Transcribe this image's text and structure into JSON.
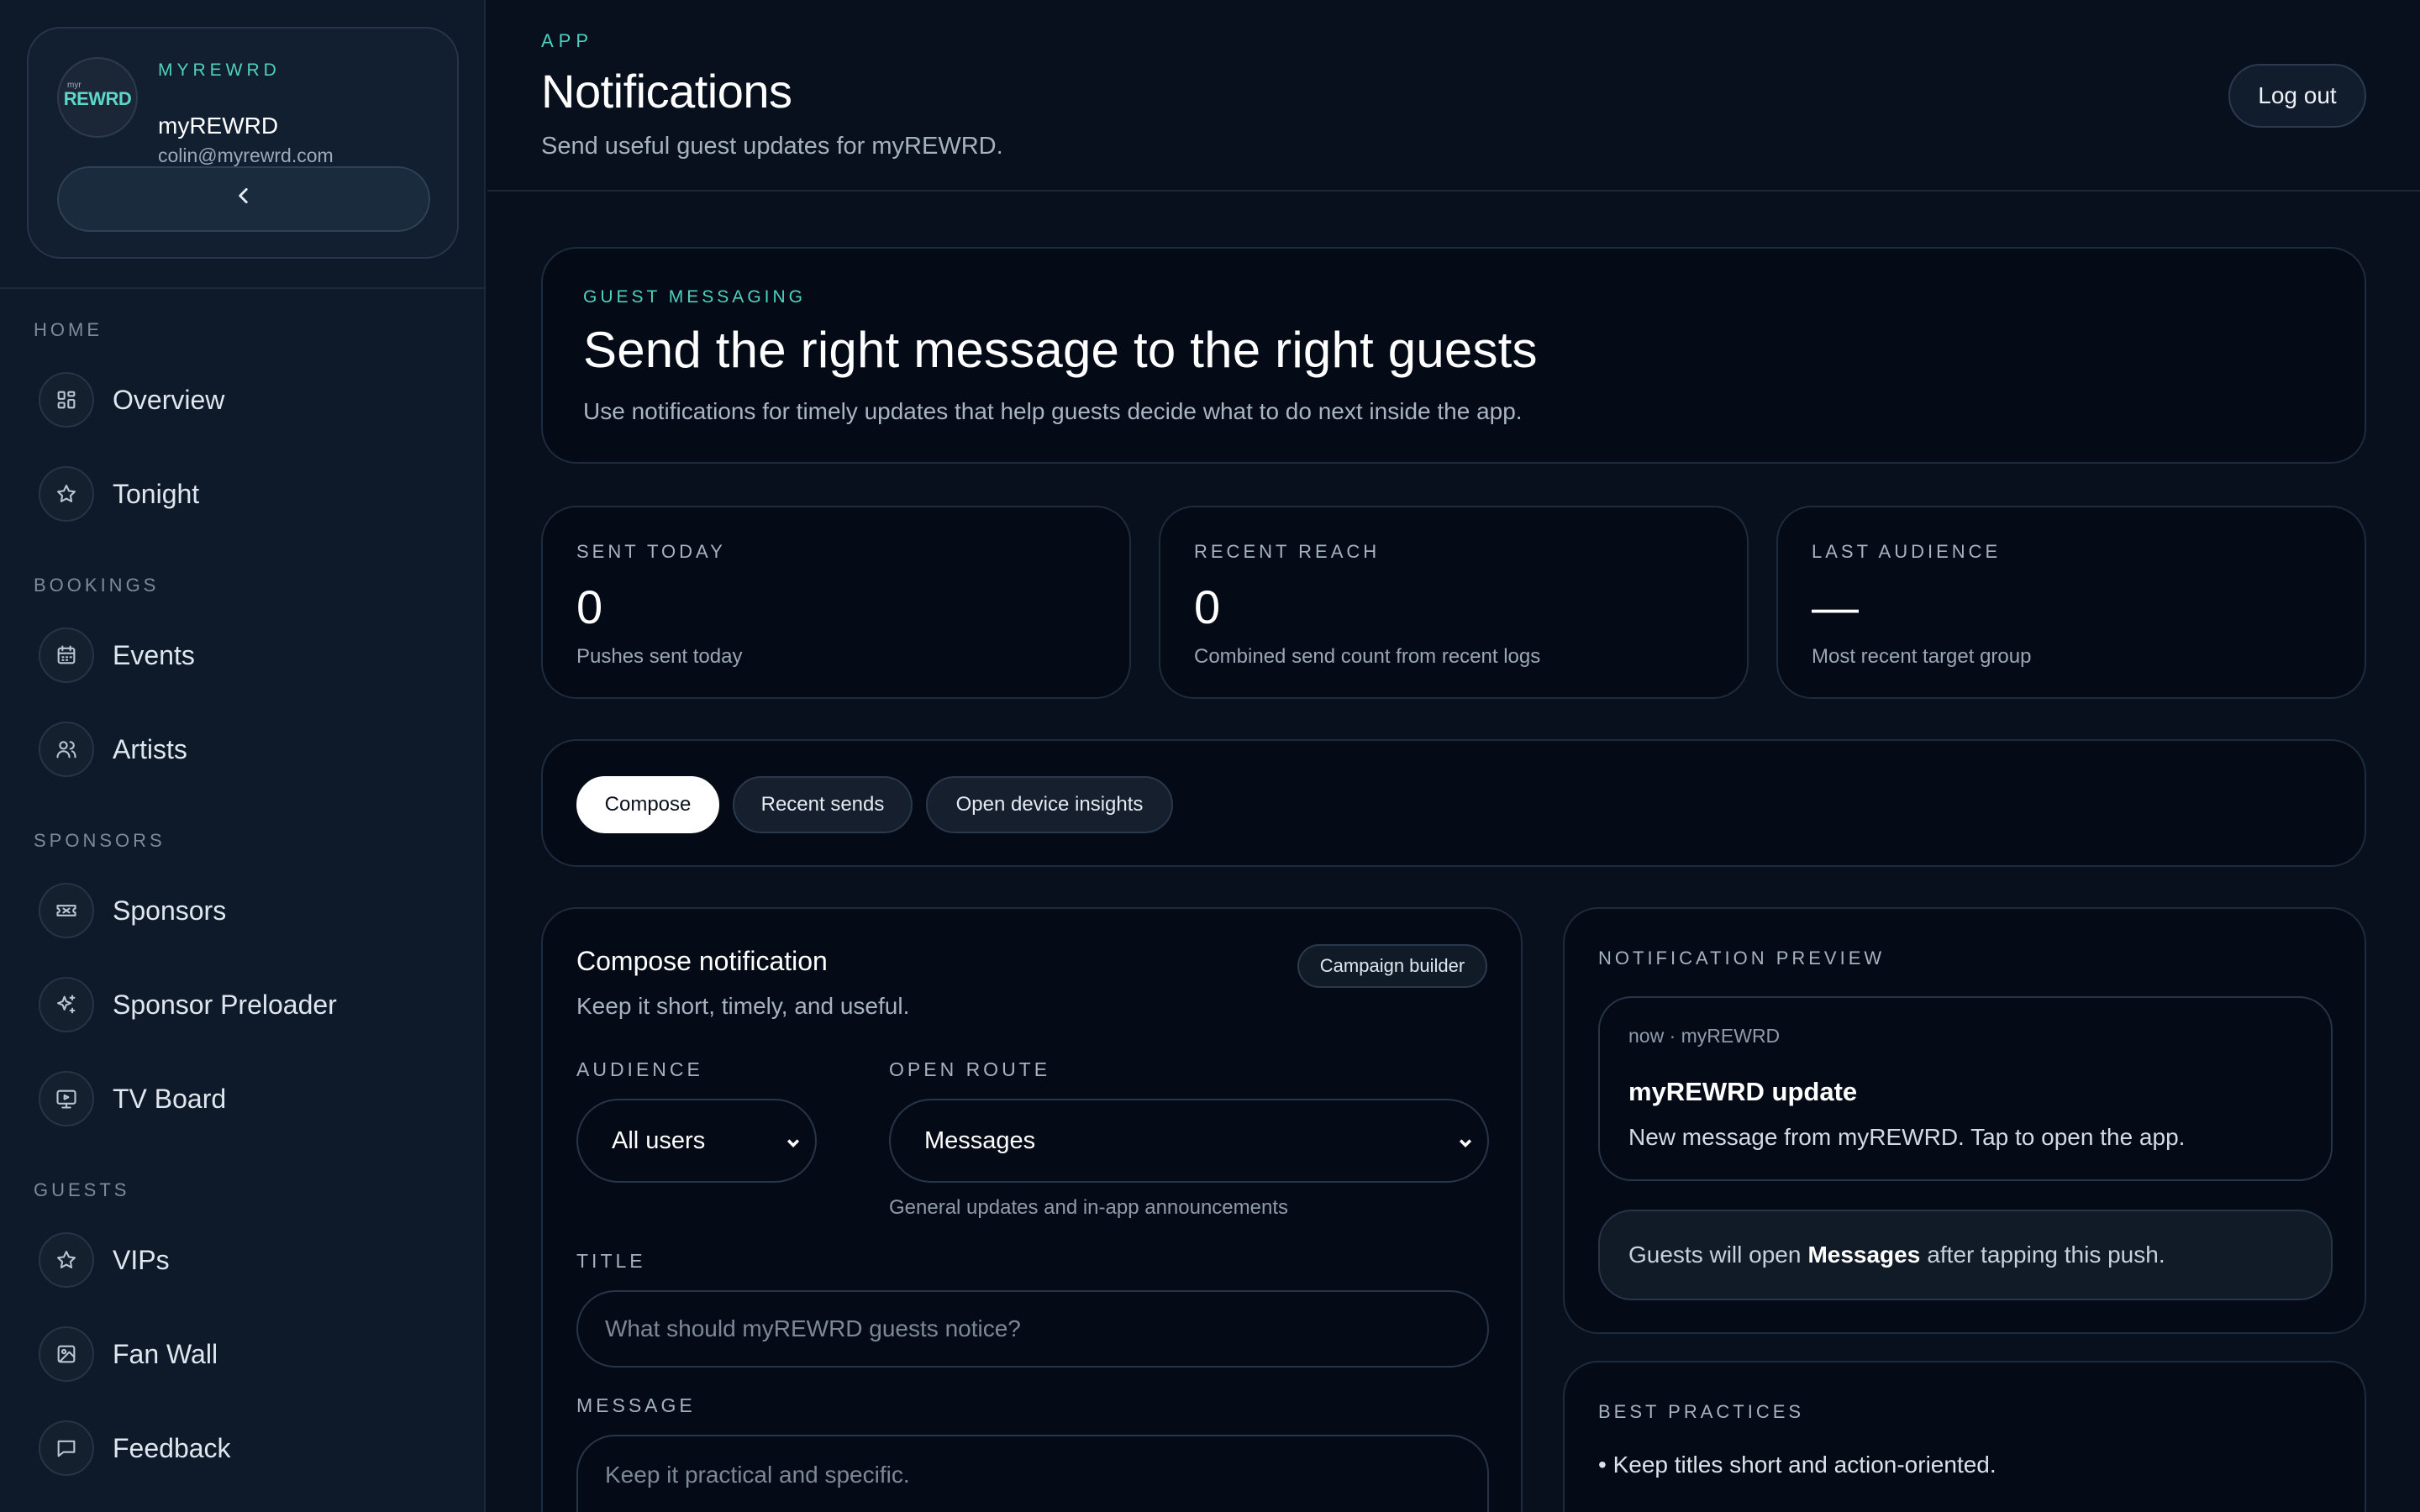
{
  "sidebar": {
    "profile": {
      "logo_small": "myr",
      "logo_text": "REWRD",
      "eyebrow": "MYREWRD",
      "name": "myREWRD",
      "email": "colin@myrewrd.com",
      "collapse_glyph": "‹"
    },
    "sections": [
      {
        "label": "HOME",
        "items": [
          {
            "label": "Overview",
            "icon": "grid-icon"
          },
          {
            "label": "Tonight",
            "icon": "star-icon"
          }
        ]
      },
      {
        "label": "BOOKINGS",
        "items": [
          {
            "label": "Events",
            "icon": "calendar-icon"
          },
          {
            "label": "Artists",
            "icon": "users-icon"
          }
        ]
      },
      {
        "label": "SPONSORS",
        "items": [
          {
            "label": "Sponsors",
            "icon": "ticket-icon"
          },
          {
            "label": "Sponsor Preloader",
            "icon": "sparkle-icon"
          },
          {
            "label": "TV Board",
            "icon": "monitor-icon"
          }
        ]
      },
      {
        "label": "GUESTS",
        "items": [
          {
            "label": "VIPs",
            "icon": "star-icon"
          },
          {
            "label": "Fan Wall",
            "icon": "image-icon"
          },
          {
            "label": "Feedback",
            "icon": "message-icon"
          }
        ]
      }
    ]
  },
  "header": {
    "eyebrow": "APP",
    "title": "Notifications",
    "subtitle": "Send useful guest updates for myREWRD.",
    "logout_label": "Log out"
  },
  "hero": {
    "eyebrow": "GUEST MESSAGING",
    "title": "Send the right message to the right guests",
    "description": "Use notifications for timely updates that help guests decide what to do next inside the app."
  },
  "stats": [
    {
      "label": "SENT TODAY",
      "value": "0",
      "caption": "Pushes sent today"
    },
    {
      "label": "RECENT REACH",
      "value": "0",
      "caption": "Combined send count from recent logs"
    },
    {
      "label": "LAST AUDIENCE",
      "value": "—",
      "caption": "Most recent target group"
    }
  ],
  "tabs": [
    {
      "label": "Compose",
      "active": true
    },
    {
      "label": "Recent sends",
      "active": false
    },
    {
      "label": "Open device insights",
      "active": false
    }
  ],
  "compose": {
    "title": "Compose notification",
    "subtitle": "Keep it short, timely, and useful.",
    "campaign_button": "Campaign builder",
    "audience_label": "AUDIENCE",
    "audience_value": "All users",
    "route_label": "OPEN ROUTE",
    "route_value": "Messages",
    "route_hint": "General updates and in-app announcements",
    "title_label": "TITLE",
    "title_placeholder": "What should myREWRD guests notice?",
    "message_label": "MESSAGE",
    "message_placeholder": "Keep it practical and specific."
  },
  "preview": {
    "eyebrow": "NOTIFICATION PREVIEW",
    "meta": "now · myREWRD",
    "title": "myREWRD update",
    "body": "New message from myREWRD. Tap to open the app.",
    "route_prefix": "Guests will open",
    "route_name": "Messages",
    "route_suffix": "after tapping this push."
  },
  "practices": {
    "eyebrow": "BEST PRACTICES",
    "items": [
      "Keep titles short and action-oriented."
    ]
  },
  "colors": {
    "accent": "#4fd1bf",
    "background": "#07101c",
    "card": "#050b16",
    "sidebar": "#0e1a2a"
  }
}
